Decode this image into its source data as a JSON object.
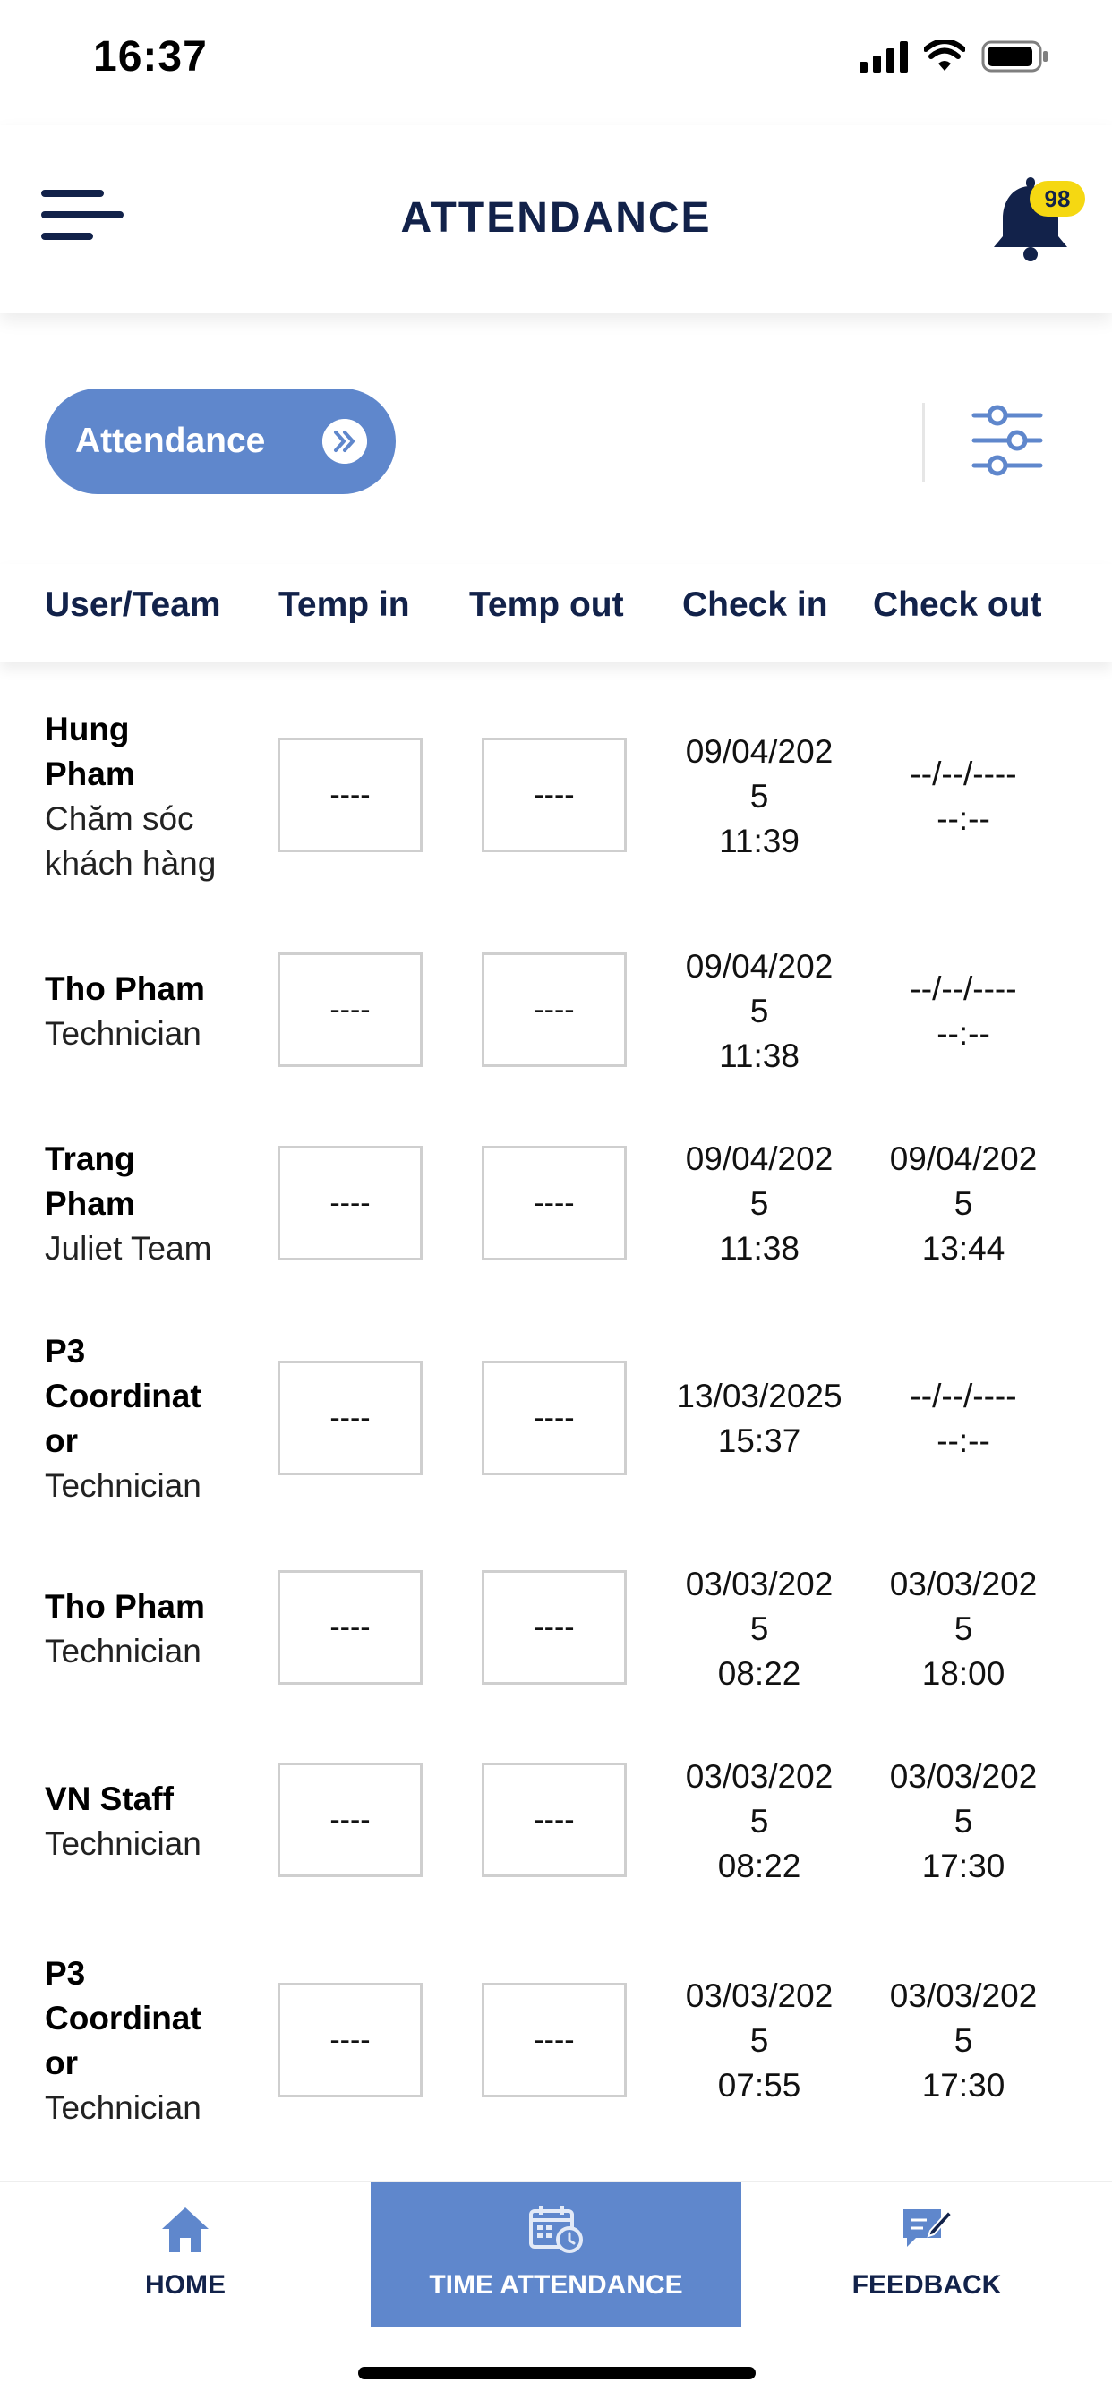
{
  "status": {
    "time": "16:37"
  },
  "header": {
    "title": "ATTENDANCE",
    "notification_count": "98"
  },
  "filter": {
    "pill_label": "Attendance"
  },
  "columns": [
    "User/Team",
    "Temp in",
    "Temp out",
    "Check in",
    "Check out"
  ],
  "rows": [
    {
      "name": [
        "Hung",
        "Pham"
      ],
      "team": [
        "Chăm sóc",
        "khách hàng"
      ],
      "temp_in": "----",
      "temp_out": "----",
      "check_in": [
        "09/04/202",
        "5",
        "11:39"
      ],
      "check_out": [
        "--/--/----",
        "--:--"
      ]
    },
    {
      "name": [
        "Tho Pham"
      ],
      "team": [
        "Technician"
      ],
      "temp_in": "----",
      "temp_out": "----",
      "check_in": [
        "09/04/202",
        "5",
        "11:38"
      ],
      "check_out": [
        "--/--/----",
        "--:--"
      ]
    },
    {
      "name": [
        "Trang",
        "Pham"
      ],
      "team": [
        "Juliet Team"
      ],
      "temp_in": "----",
      "temp_out": "----",
      "check_in": [
        "09/04/202",
        "5",
        "11:38"
      ],
      "check_out": [
        "09/04/202",
        "5",
        "13:44"
      ]
    },
    {
      "name": [
        "P3",
        "Coordinat",
        "or"
      ],
      "team": [
        "Technician"
      ],
      "temp_in": "----",
      "temp_out": "----",
      "check_in": [
        "13/03/2025",
        "15:37"
      ],
      "check_out": [
        "--/--/----",
        "--:--"
      ]
    },
    {
      "name": [
        "Tho Pham"
      ],
      "team": [
        "Technician"
      ],
      "temp_in": "----",
      "temp_out": "----",
      "check_in": [
        "03/03/202",
        "5",
        "08:22"
      ],
      "check_out": [
        "03/03/202",
        "5",
        "18:00"
      ]
    },
    {
      "name": [
        "VN Staff"
      ],
      "team": [
        "Technician"
      ],
      "temp_in": "----",
      "temp_out": "----",
      "check_in": [
        "03/03/202",
        "5",
        "08:22"
      ],
      "check_out": [
        "03/03/202",
        "5",
        "17:30"
      ]
    },
    {
      "name": [
        "P3",
        "Coordinat",
        "or"
      ],
      "team": [
        "Technician"
      ],
      "temp_in": "----",
      "temp_out": "----",
      "check_in": [
        "03/03/202",
        "5",
        "07:55"
      ],
      "check_out": [
        "03/03/202",
        "5",
        "17:30"
      ]
    }
  ],
  "tabs": [
    {
      "label": "HOME",
      "icon": "home-icon",
      "active": false
    },
    {
      "label": "TIME ATTENDANCE",
      "icon": "calendar-clock-icon",
      "active": true
    },
    {
      "label": "FEEDBACK",
      "icon": "feedback-icon",
      "active": false
    }
  ],
  "colors": {
    "accent": "#5f87cc",
    "navy": "#12224a",
    "badge": "#f5d812"
  }
}
